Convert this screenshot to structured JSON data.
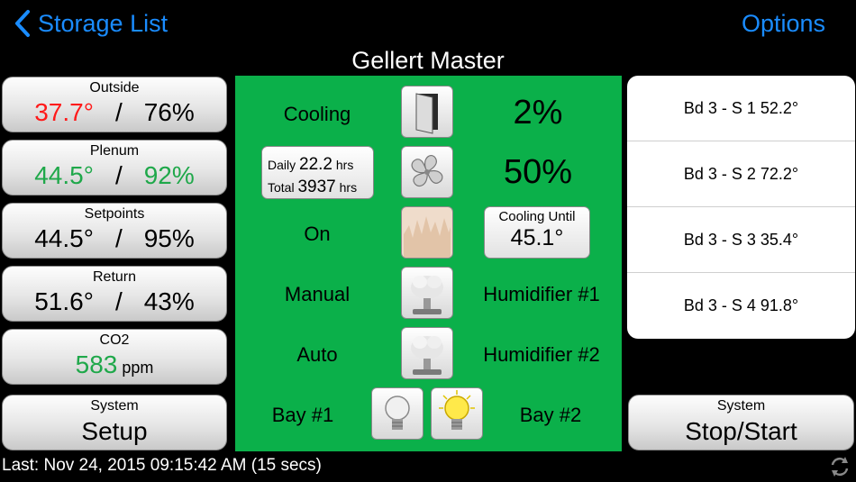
{
  "nav": {
    "back_label": "Storage List",
    "options_label": "Options"
  },
  "title": "Gellert Master",
  "left_tiles": {
    "outside": {
      "label": "Outside",
      "temp": "37.7°",
      "sep": "/",
      "humidity": "76%"
    },
    "plenum": {
      "label": "Plenum",
      "temp": "44.5°",
      "sep": "/",
      "humidity": "92%"
    },
    "setpoints": {
      "label": "Setpoints",
      "temp": "44.5°",
      "sep": "/",
      "humidity": "95%"
    },
    "return": {
      "label": "Return",
      "temp": "51.6°",
      "sep": "/",
      "humidity": "43%"
    },
    "co2": {
      "label": "CO2",
      "value": "583",
      "unit": "ppm"
    },
    "system_setup": {
      "label": "System",
      "action": "Setup"
    }
  },
  "center": {
    "cooling_label": "Cooling",
    "cooling_pct": "2%",
    "fan_daily_label": "Daily",
    "fan_daily_value": "22.2",
    "fan_daily_unit": "hrs",
    "fan_total_label": "Total",
    "fan_total_value": "3937",
    "fan_total_unit": "hrs",
    "fan_pct": "50%",
    "heat_state": "On",
    "cooling_until_label": "Cooling Until",
    "cooling_until_value": "45.1°",
    "humidifier1_mode": "Manual",
    "humidifier1_label": "Humidifier #1",
    "humidifier2_mode": "Auto",
    "humidifier2_label": "Humidifier #2",
    "bay1_label": "Bay #1",
    "bay2_label": "Bay #2"
  },
  "sensors": [
    "Bd 3 - S 1 52.2°",
    "Bd 3 - S 2 72.2°",
    "Bd 3 - S 3 35.4°",
    "Bd 3 - S 4 91.8°"
  ],
  "system_stop": {
    "label": "System",
    "action": "Stop/Start"
  },
  "status_text": "Last: Nov 24, 2015 09:15:42 AM (15 secs)",
  "colors": {
    "accent": "#1a8cff",
    "panel_green": "#0bb04a",
    "warn_red": "#ff1a1a",
    "ok_green": "#1fa84a"
  }
}
